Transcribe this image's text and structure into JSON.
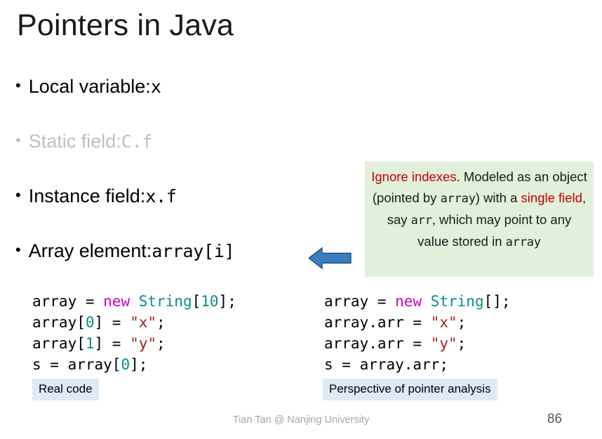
{
  "slide": {
    "title": "Pointers in Java",
    "page_number": "86",
    "credit": "Tian Tan @ Nanjing University",
    "background_color": "#ffffff"
  },
  "bullets": [
    {
      "label": "Local variable: ",
      "code": "x",
      "dimmed": false
    },
    {
      "label": "Static field: ",
      "code": "C.f",
      "dimmed": true
    },
    {
      "label": "Instance field: ",
      "code": "x.f",
      "dimmed": false
    },
    {
      "label": "Array element: ",
      "code": "array[i]",
      "dimmed": false
    }
  ],
  "arrow": {
    "direction": "left",
    "fill_color": "#3a7ebf",
    "stroke_color": "#1f4e79"
  },
  "note_box": {
    "background_color": "#e2efda",
    "highlight_color": "#c00000",
    "segments": [
      {
        "text": "Ignore indexes",
        "style": "highlight"
      },
      {
        "text": ". Modeled as an object (pointed by ",
        "style": "plain"
      },
      {
        "text": "array",
        "style": "mono"
      },
      {
        "text": ") with a ",
        "style": "plain"
      },
      {
        "text": "single field",
        "style": "highlight"
      },
      {
        "text": ", say ",
        "style": "plain"
      },
      {
        "text": "arr",
        "style": "mono"
      },
      {
        "text": ", which may point to any value stored in ",
        "style": "plain"
      },
      {
        "text": "array",
        "style": "mono"
      }
    ]
  },
  "code_left": {
    "caption": "Real code",
    "lines": [
      [
        {
          "t": "array = ",
          "c": "plain"
        },
        {
          "t": "new ",
          "c": "keyword"
        },
        {
          "t": "String",
          "c": "type"
        },
        {
          "t": "[",
          "c": "plain"
        },
        {
          "t": "10",
          "c": "number"
        },
        {
          "t": "];",
          "c": "plain"
        }
      ],
      [
        {
          "t": "array[",
          "c": "plain"
        },
        {
          "t": "0",
          "c": "number"
        },
        {
          "t": "] = ",
          "c": "plain"
        },
        {
          "t": "\"x\"",
          "c": "string"
        },
        {
          "t": ";",
          "c": "plain"
        }
      ],
      [
        {
          "t": "array[",
          "c": "plain"
        },
        {
          "t": "1",
          "c": "number"
        },
        {
          "t": "] = ",
          "c": "plain"
        },
        {
          "t": "\"y\"",
          "c": "string"
        },
        {
          "t": ";",
          "c": "plain"
        }
      ],
      [
        {
          "t": "s = array[",
          "c": "plain"
        },
        {
          "t": "0",
          "c": "number"
        },
        {
          "t": "];",
          "c": "plain"
        }
      ]
    ]
  },
  "code_right": {
    "caption": "Perspective of pointer analysis",
    "lines": [
      [
        {
          "t": "array = ",
          "c": "plain"
        },
        {
          "t": "new ",
          "c": "keyword"
        },
        {
          "t": "String",
          "c": "type"
        },
        {
          "t": "[];",
          "c": "plain"
        }
      ],
      [
        {
          "t": "array.arr = ",
          "c": "plain"
        },
        {
          "t": "\"x\"",
          "c": "string"
        },
        {
          "t": ";",
          "c": "plain"
        }
      ],
      [
        {
          "t": "array.arr = ",
          "c": "plain"
        },
        {
          "t": "\"y\"",
          "c": "string"
        },
        {
          "t": ";",
          "c": "plain"
        }
      ],
      [
        {
          "t": "s = array.arr;",
          "c": "plain"
        }
      ]
    ]
  },
  "caption_style": {
    "background_color": "#deeaf6"
  }
}
